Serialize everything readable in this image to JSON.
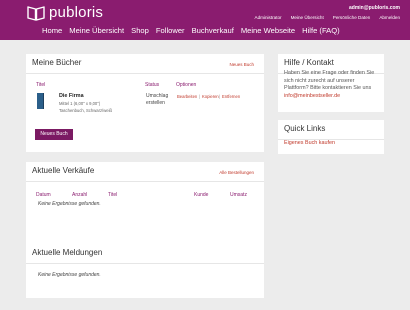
{
  "header": {
    "logo_text": "publoris",
    "user_email": "admin@publoris.com",
    "user_links": [
      "Administrator",
      "Meine Übersicht",
      "Persönliche Daten",
      "Abmelden"
    ],
    "nav": [
      "Home",
      "Meine Übersicht",
      "Shop",
      "Follower",
      "Buchverkauf",
      "Meine Webseite",
      "Hilfe (FAQ)"
    ]
  },
  "books": {
    "title": "Meine Bücher",
    "new_link": "Neues Buch",
    "col_title": "Titel",
    "col_status": "Status",
    "col_options": "Optionen",
    "book_title": "Die Firma",
    "book_meta_1": "Mittel 1 (6,00\" x 9,00\")",
    "book_meta_2": "Taschenbuch, Schwarz/weiß",
    "status_1": "Umschlag",
    "status_2": "erstellen",
    "opt_edit": "Bearbeiten",
    "opt_copy": "Kopieren",
    "opt_delete": "Entfernen",
    "opt_sep": "|",
    "button": "Neues Buch"
  },
  "sales": {
    "title": "Aktuelle Verkäufe",
    "all_link": "Alle Bestellungen",
    "columns": [
      "Datum",
      "Anzahl",
      "Titel",
      "Kunde",
      "Umsatz"
    ],
    "empty": "Keine Ergebnisse gefunden."
  },
  "messages": {
    "title": "Aktuelle Meldungen",
    "empty": "Keine Ergebnisse gefunden."
  },
  "help": {
    "title": "Hilfe / Kontakt",
    "text": "Haben Sie eine Frage oder finden Sie sich nicht zurecht auf unserer Plattform? Bitte kontaktieren Sie uns",
    "email": "info@meinbestseller.de"
  },
  "quicklinks": {
    "title": "Quick Links",
    "link": "Eigenes Buch kaufen"
  }
}
